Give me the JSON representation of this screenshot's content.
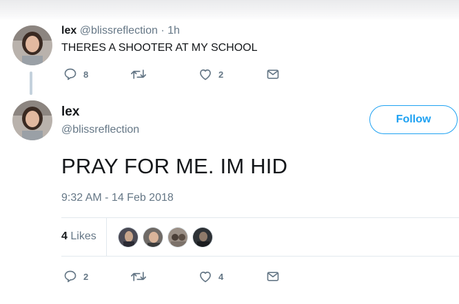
{
  "tweet1": {
    "name": "lex",
    "handle": "@blissreflection",
    "time": "· 1h",
    "text": "THERES A SHOOTER AT MY SCHOOL",
    "reply_count": "8",
    "like_count": "2"
  },
  "tweet2": {
    "name": "lex",
    "handle": "@blissreflection",
    "follow_label": "Follow",
    "text": "PRAY FOR ME. IM HID",
    "timestamp": "9:32 AM - 14 Feb 2018",
    "likes_count": "4",
    "likes_label": "Likes",
    "reply_count": "2",
    "like_count": "4"
  },
  "icons": [
    "reply-icon",
    "retweet-icon",
    "heart-icon",
    "message-icon"
  ],
  "colors": {
    "accent": "#1da1f2",
    "muted": "#657786",
    "thread": "#c4d1dc"
  }
}
